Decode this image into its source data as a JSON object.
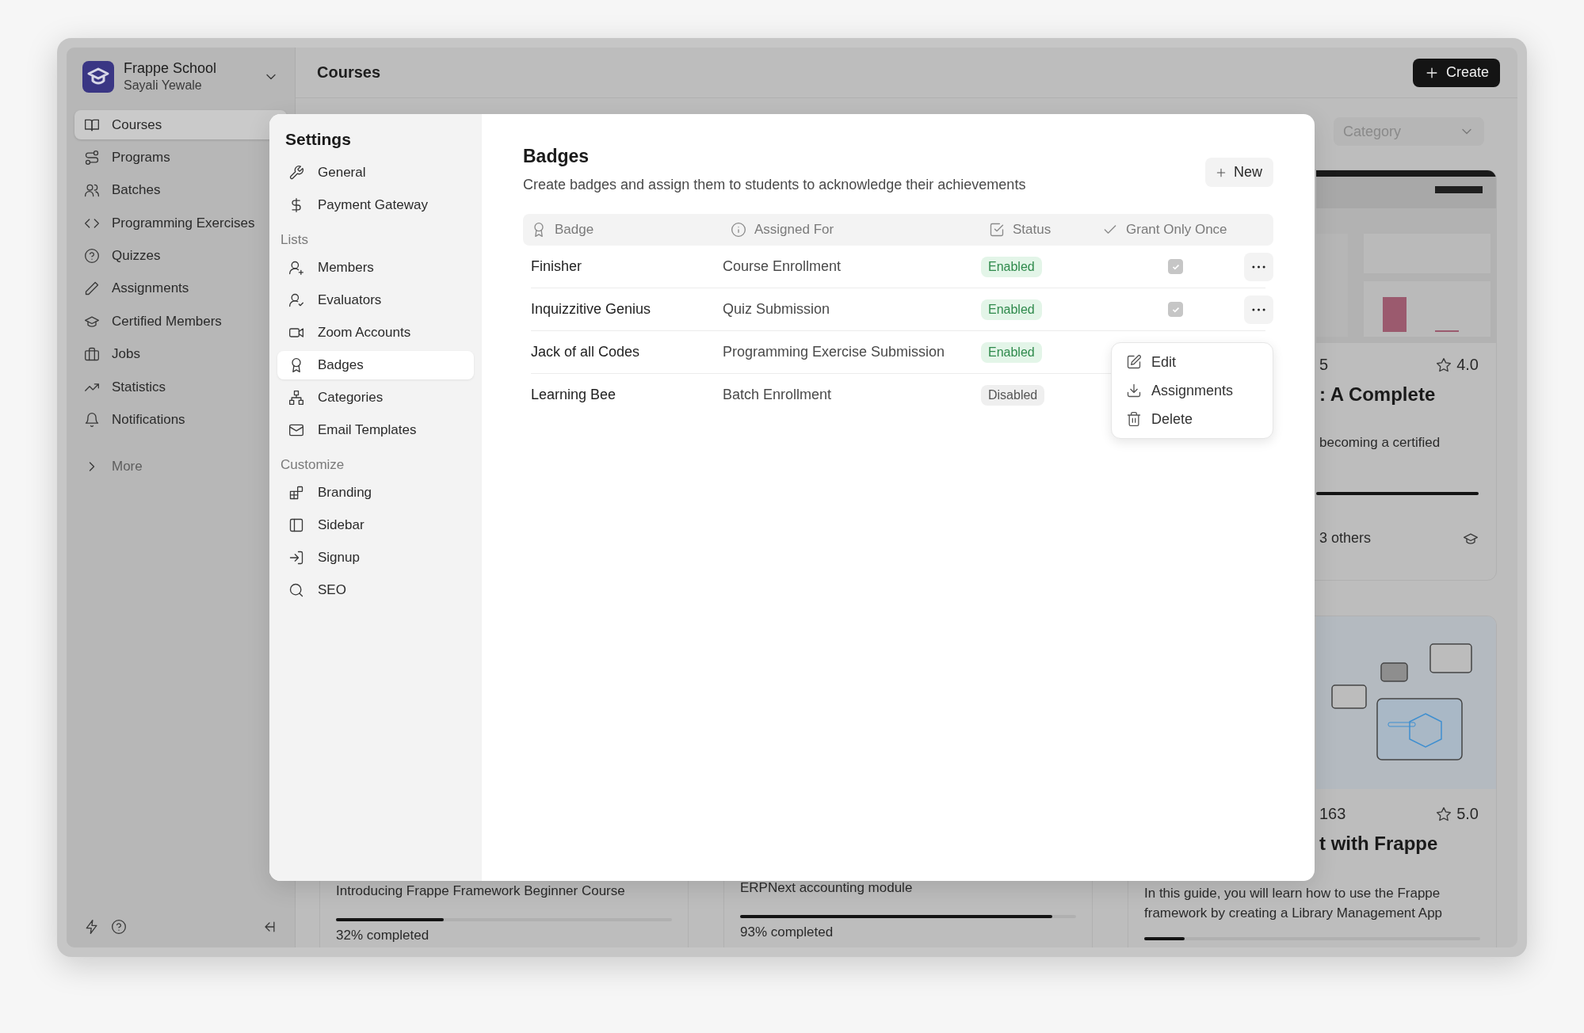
{
  "app": {
    "org": "Frappe School",
    "user": "Sayali Yewale"
  },
  "sidebar": {
    "items": [
      {
        "label": "Courses",
        "selected": true
      },
      {
        "label": "Programs",
        "selected": false
      },
      {
        "label": "Batches",
        "selected": false
      },
      {
        "label": "Programming Exercises",
        "selected": false
      },
      {
        "label": "Quizzes",
        "selected": false
      },
      {
        "label": "Assignments",
        "selected": false
      },
      {
        "label": "Certified Members",
        "selected": false
      },
      {
        "label": "Jobs",
        "selected": false
      },
      {
        "label": "Statistics",
        "selected": false
      },
      {
        "label": "Notifications",
        "selected": false
      }
    ],
    "more": "More"
  },
  "header": {
    "title": "Courses",
    "create_button": "Create"
  },
  "filters": {
    "category": {
      "placeholder": "Category"
    }
  },
  "course_cards": [
    {
      "kind": "partial",
      "count": "5",
      "rating": "4.0",
      "title": ": A Complete",
      "description": "becoming a certified",
      "progress": {
        "level": 1
      },
      "instructors": "3 others"
    },
    {
      "kind": "bottom",
      "description": "Introducing Frappe Framework Beginner Course",
      "progress": {
        "level": 0.32
      },
      "status": "32% completed"
    },
    {
      "kind": "bottom",
      "description": "ERPNext accounting module",
      "progress": {
        "level": 0.93
      },
      "status": "93% completed"
    },
    {
      "kind": "partial",
      "count": "163",
      "rating": "5.0",
      "title": "t with Frappe",
      "description": "In this guide, you will learn how to use the Frappe framework by creating a Library Management App",
      "progress": {
        "level": 0.12
      }
    }
  ],
  "settings": {
    "title": "Settings",
    "groups": [
      {
        "items": [
          {
            "label": "General",
            "selected": false
          },
          {
            "label": "Payment Gateway",
            "selected": false
          }
        ]
      },
      {
        "label": "Lists",
        "items": [
          {
            "label": "Members",
            "selected": false
          },
          {
            "label": "Evaluators",
            "selected": false
          },
          {
            "label": "Zoom Accounts",
            "selected": false
          },
          {
            "label": "Badges",
            "selected": true
          },
          {
            "label": "Categories",
            "selected": false
          },
          {
            "label": "Email Templates",
            "selected": false
          }
        ]
      },
      {
        "label": "Customize",
        "items": [
          {
            "label": "Branding",
            "selected": false
          },
          {
            "label": "Sidebar",
            "selected": false
          },
          {
            "label": "Signup",
            "selected": false
          },
          {
            "label": "SEO",
            "selected": false
          }
        ]
      }
    ],
    "page": {
      "title": "Badges",
      "description": "Create badges and assign them to students to acknowledge their achievements",
      "new_button": "New",
      "table": {
        "columns": [
          "Badge",
          "Assigned For",
          "Status",
          "Grant Only Once"
        ],
        "rows": [
          {
            "badge": "Finisher",
            "assigned_for": "Course Enrollment",
            "status": {
              "label": "Enabled",
              "enabled": true
            },
            "grant_only_once": {
              "checked": true
            },
            "actions": true
          },
          {
            "badge": "Inquizzitive Genius",
            "assigned_for": "Quiz Submission",
            "status": {
              "label": "Enabled",
              "enabled": true
            },
            "grant_only_once": {
              "checked": true
            },
            "actions": true
          },
          {
            "badge": "Jack of all Codes",
            "assigned_for": "Programming Exercise Submission",
            "status": {
              "label": "Enabled",
              "enabled": true
            }
          },
          {
            "badge": "Learning Bee",
            "assigned_for": "Batch Enrollment",
            "status": {
              "label": "Disabled",
              "enabled": false
            }
          }
        ]
      },
      "menu": {
        "items": [
          "Edit",
          "Assignments",
          "Delete"
        ]
      }
    }
  }
}
